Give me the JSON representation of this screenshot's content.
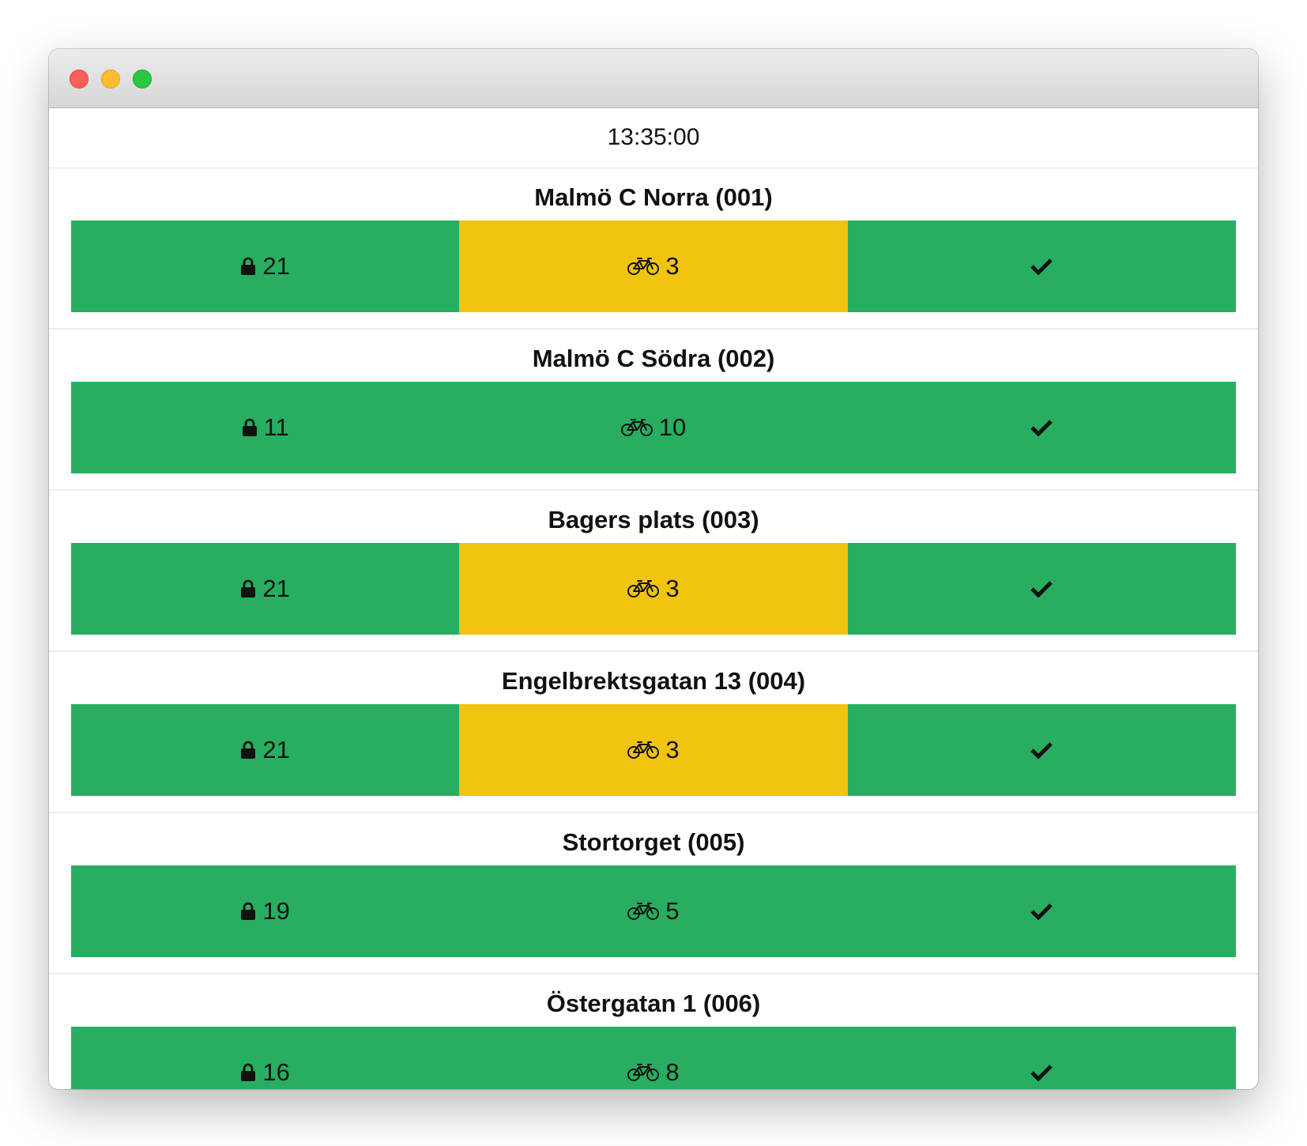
{
  "window": {
    "traffic_lights": [
      {
        "name": "close",
        "color": "#fe5f57"
      },
      {
        "name": "minimize",
        "color": "#febc2e"
      },
      {
        "name": "maximize",
        "color": "#28c840"
      }
    ]
  },
  "clock": "13:35:00",
  "colors": {
    "ok": "#27ae60",
    "warning": "#f1c40f"
  },
  "icons": {
    "docks": "lock-icon",
    "bikes": "bicycle-icon",
    "status": "check-icon"
  },
  "stations": [
    {
      "name": "Malmö C Norra (001)",
      "docks": "21",
      "bikes": "3",
      "docks_status": "ok",
      "bikes_status": "warning",
      "status": "ok"
    },
    {
      "name": "Malmö C Södra (002)",
      "docks": "11",
      "bikes": "10",
      "docks_status": "ok",
      "bikes_status": "ok",
      "status": "ok"
    },
    {
      "name": "Bagers plats (003)",
      "docks": "21",
      "bikes": "3",
      "docks_status": "ok",
      "bikes_status": "warning",
      "status": "ok"
    },
    {
      "name": "Engelbrektsgatan 13 (004)",
      "docks": "21",
      "bikes": "3",
      "docks_status": "ok",
      "bikes_status": "warning",
      "status": "ok"
    },
    {
      "name": "Stortorget (005)",
      "docks": "19",
      "bikes": "5",
      "docks_status": "ok",
      "bikes_status": "ok",
      "status": "ok"
    },
    {
      "name": "Östergatan 1 (006)",
      "docks": "16",
      "bikes": "8",
      "docks_status": "ok",
      "bikes_status": "ok",
      "status": "ok"
    }
  ]
}
